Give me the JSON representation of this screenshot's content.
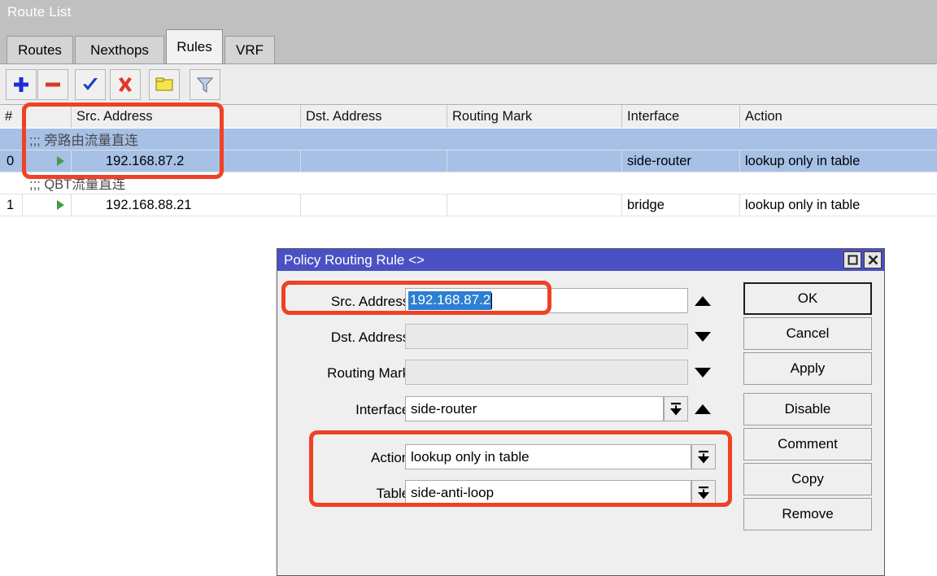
{
  "window": {
    "title": "Route List"
  },
  "tabs": [
    {
      "label": "Routes",
      "active": false
    },
    {
      "label": "Nexthops",
      "active": false
    },
    {
      "label": "Rules",
      "active": true
    },
    {
      "label": "VRF",
      "active": false
    }
  ],
  "toolbar": {
    "buttons": [
      {
        "icon": "plus-icon",
        "title": "Add"
      },
      {
        "icon": "minus-icon",
        "title": "Remove"
      },
      {
        "icon": "check-icon",
        "title": "Enable"
      },
      {
        "icon": "cross-icon",
        "title": "Disable"
      },
      {
        "icon": "comment-icon",
        "title": "Comment"
      },
      {
        "icon": "filter-icon",
        "title": "Filter"
      }
    ]
  },
  "table": {
    "columns": [
      "#",
      "",
      "Src. Address",
      "Dst. Address",
      "Routing Mark",
      "Interface",
      "Action"
    ],
    "rows": [
      {
        "type": "comment",
        "comment": ";;; 旁路由流量直连",
        "selected": true
      },
      {
        "type": "data",
        "num": "0",
        "flag": "green-triangle-icon",
        "src_address": "192.168.87.2",
        "dst_address": "",
        "routing_mark": "",
        "interface": "side-router",
        "action": "lookup only in table",
        "selected": true
      },
      {
        "type": "comment",
        "comment": ";;; QBT流量直连",
        "selected": false
      },
      {
        "type": "data",
        "num": "1",
        "flag": "green-triangle-icon",
        "src_address": "192.168.88.21",
        "dst_address": "",
        "routing_mark": "",
        "interface": "bridge",
        "action": "lookup only in table",
        "selected": false
      }
    ]
  },
  "dialog": {
    "title": "Policy Routing Rule <>",
    "window_buttons": {
      "maximize": "maximize-icon",
      "close": "close-icon"
    },
    "fields": {
      "src_address": {
        "label": "Src. Address:",
        "value": "192.168.87.2",
        "selected": true,
        "arrow": "up"
      },
      "dst_address": {
        "label": "Dst. Address:",
        "value": "",
        "arrow": "down"
      },
      "routing_mark": {
        "label": "Routing Mark:",
        "value": "",
        "arrow": "down"
      },
      "interface": {
        "label": "Interface:",
        "value": "side-router",
        "arrow": "up",
        "has_dropdown": true
      },
      "action": {
        "label": "Action:",
        "value": "lookup only in table",
        "has_dropdown": true
      },
      "table": {
        "label": "Table:",
        "value": "side-anti-loop",
        "has_dropdown": true
      }
    },
    "buttons": [
      {
        "label": "OK",
        "default": true
      },
      {
        "label": "Cancel",
        "default": false
      },
      {
        "label": "Apply",
        "default": false
      },
      {
        "label": "Disable",
        "default": false
      },
      {
        "label": "Comment",
        "default": false
      },
      {
        "label": "Copy",
        "default": false
      },
      {
        "label": "Remove",
        "default": false
      }
    ]
  },
  "annotations": {
    "color": "#ef4123",
    "boxes": [
      {
        "name": "table-src-address-highlight"
      },
      {
        "name": "dialog-src-address-highlight"
      },
      {
        "name": "dialog-action-table-highlight"
      }
    ]
  },
  "colors": {
    "window_titlebar": "#c0c0c0",
    "dialog_titlebar": "#4a51c4",
    "row_selected": "#a6c0e6",
    "text_selection": "#2b7fd4",
    "annotation": "#ef4123",
    "flag_green": "#3f9f3f"
  }
}
